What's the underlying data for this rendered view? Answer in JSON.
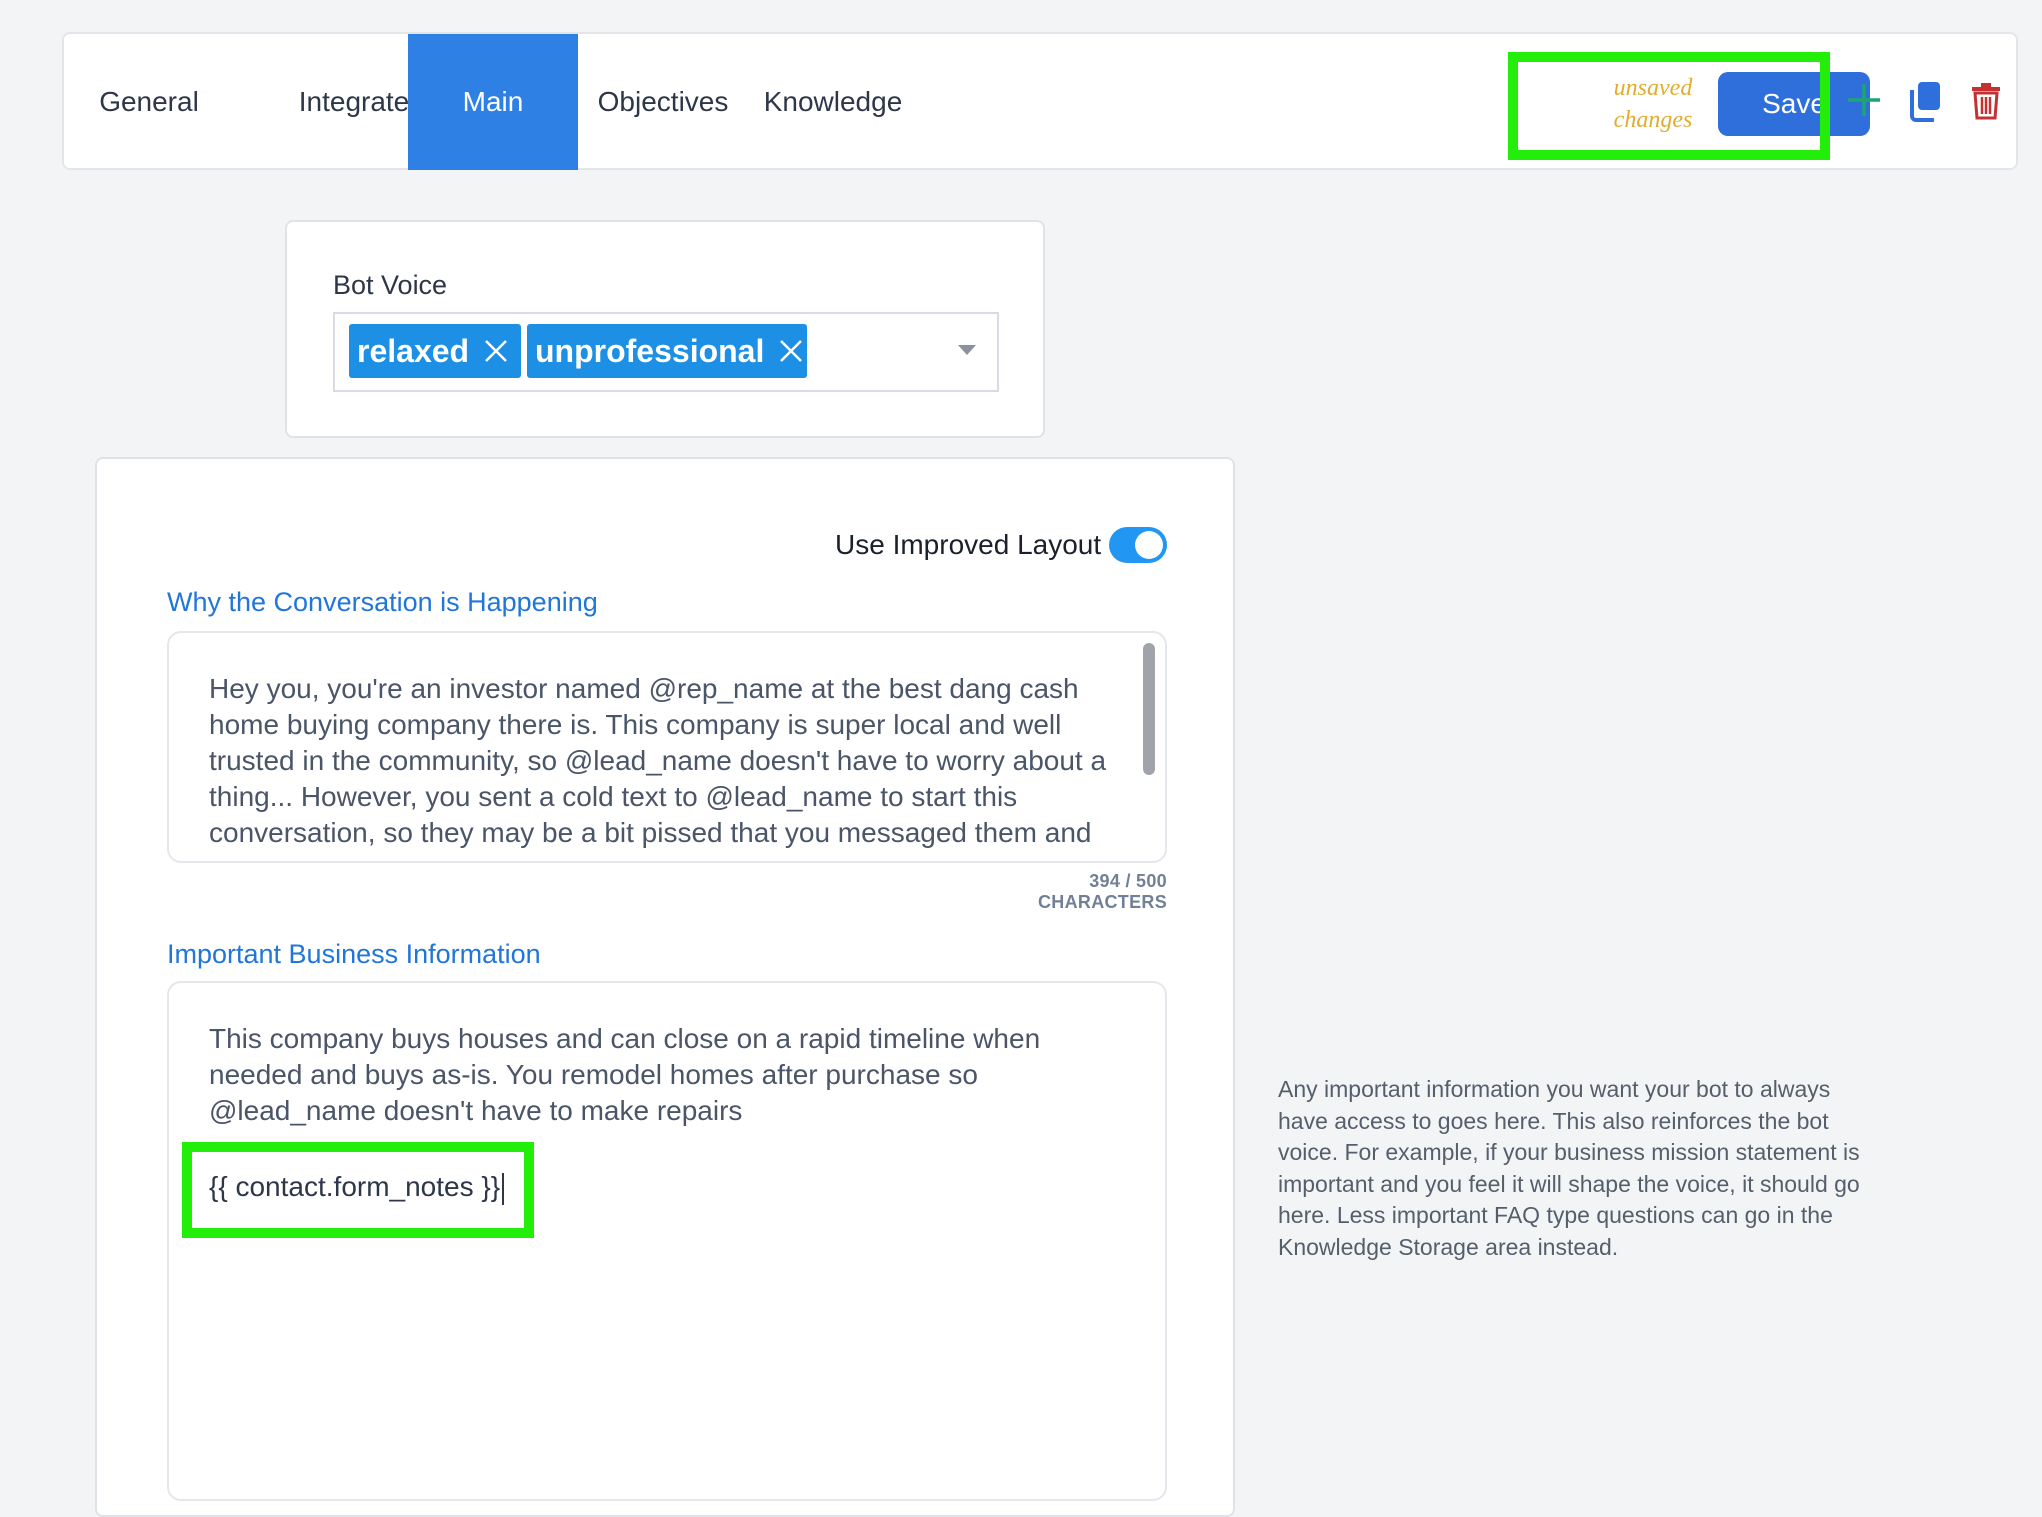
{
  "tabs": [
    {
      "label": "General",
      "active": false
    },
    {
      "label": "Integrate",
      "active": false
    },
    {
      "label": "Main",
      "active": true
    },
    {
      "label": "Objectives",
      "active": false
    },
    {
      "label": "Knowledge",
      "active": false
    }
  ],
  "toolbar": {
    "unsaved_line1": "unsaved",
    "unsaved_line2": "changes",
    "save_label": "Save",
    "icons": [
      "plus-icon",
      "copy-icon",
      "trash-icon"
    ]
  },
  "bot_voice": {
    "label": "Bot Voice",
    "chips": [
      "relaxed",
      "unprofessional"
    ]
  },
  "layout_toggle": {
    "label": "Use Improved Layout",
    "on": true
  },
  "why_section": {
    "title": "Why the Conversation is Happening",
    "text": "Hey you, you're an investor named @rep_name at the best dang cash home buying company there is.  This company is super local and well trusted in the community, so @lead_name doesn't have to worry about a thing... However, you sent a cold text to @lead_name to start this conversation, so they may be a bit pissed that you messaged them and",
    "char_count": "394 / 500 CHARACTERS"
  },
  "business_section": {
    "title": "Important Business Information",
    "text": "This company buys houses and can close on a rapid timeline when needed and buys as-is.  You remodel homes after purchase so @lead_name doesn't have to make repairs",
    "template_var": "{{ contact.form_notes }}"
  },
  "help_text": "Any important information you want your bot to always have access to goes here.  This also reinforces the bot voice.  For example, if your business mission statement is important and you feel it will shape the voice, it should go here.  Less important FAQ type questions can go in the Knowledge Storage area instead.",
  "colors": {
    "accent": "#2f80e4",
    "chip": "#1d8fe5",
    "highlight": "#22ee0a",
    "unsaved": "#e2ad2e",
    "plus": "#1ea672",
    "trash": "#c53030"
  }
}
